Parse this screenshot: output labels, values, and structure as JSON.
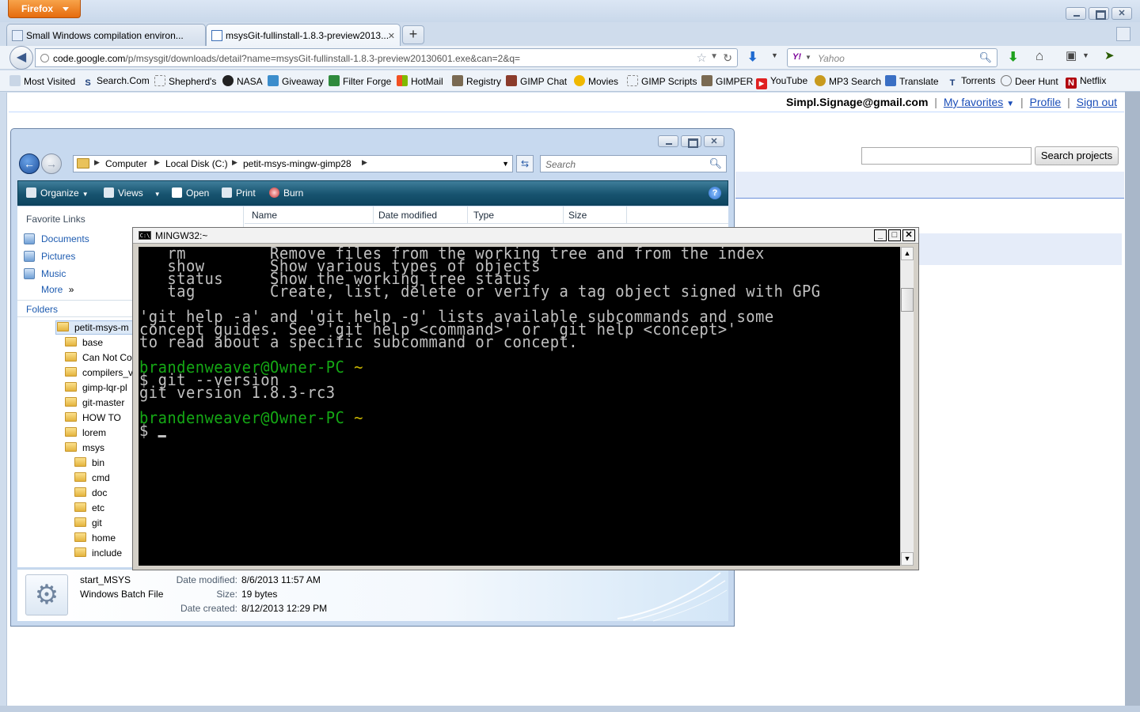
{
  "firefox": {
    "menu_button": "Firefox",
    "tabs": [
      {
        "label": "Small Windows compilation environ..."
      },
      {
        "label": "msysGit-fullinstall-1.8.3-preview2013..."
      }
    ],
    "url": {
      "host": "code.google.com",
      "path": "/p/msysgit/downloads/detail?name=msysGit-fullinstall-1.8.3-preview20130601.exe&can=2&q="
    },
    "search_placeholder": "Yahoo",
    "bookmarks": [
      {
        "label": "Most Visited",
        "icon": "star-icon"
      },
      {
        "label": "Search.Com",
        "icon": "search-com-icon"
      },
      {
        "label": "Shepherd's",
        "icon": "page-icon"
      },
      {
        "label": "NASA",
        "icon": "nasa-icon"
      },
      {
        "label": "Giveaway",
        "icon": "giveaway-icon"
      },
      {
        "label": "Filter Forge",
        "icon": "filter-forge-icon"
      },
      {
        "label": "HotMail",
        "icon": "windows-icon"
      },
      {
        "label": "Registry",
        "icon": "gimp-icon"
      },
      {
        "label": "GIMP Chat",
        "icon": "gimp-chat-icon"
      },
      {
        "label": "Movies",
        "icon": "movies-icon"
      },
      {
        "label": "GIMP Scripts",
        "icon": "page-icon"
      },
      {
        "label": "GIMPER",
        "icon": "gimp-icon"
      },
      {
        "label": "YouTube",
        "icon": "youtube-icon"
      },
      {
        "label": "MP3 Search",
        "icon": "mp3-icon"
      },
      {
        "label": "Translate",
        "icon": "translate-icon"
      },
      {
        "label": "Torrents",
        "icon": "torrents-icon"
      },
      {
        "label": "Deer Hunt",
        "icon": "deer-hunt-icon"
      },
      {
        "label": "Netflix",
        "icon": "netflix-icon"
      }
    ]
  },
  "page": {
    "account_email": "Simpl.Signage@gmail.com",
    "my_favorites": "My favorites",
    "favorites_arrow": "▼",
    "profile": "Profile",
    "sign_out": "Sign out",
    "sep": "|",
    "search_button": "Search projects"
  },
  "explorer": {
    "breadcrumb": [
      "Computer",
      "Local Disk (C:)",
      "petit-msys-mingw-gimp28"
    ],
    "search_placeholder": "Search",
    "toolbar": {
      "organize": "Organize",
      "views": "Views",
      "open": "Open",
      "print": "Print",
      "burn": "Burn"
    },
    "favorite_links_title": "Favorite Links",
    "favorite_links": [
      "Documents",
      "Pictures",
      "Music"
    ],
    "more": "More",
    "more_arrows": "»",
    "folders_title": "Folders",
    "tree": [
      {
        "label": "petit-msys-m",
        "level": 0
      },
      {
        "label": "base",
        "level": 1
      },
      {
        "label": "Can Not Co",
        "level": 1
      },
      {
        "label": "compilers_v",
        "level": 1
      },
      {
        "label": "gimp-lqr-pl",
        "level": 1
      },
      {
        "label": "git-master",
        "level": 1
      },
      {
        "label": "HOW TO",
        "level": 1
      },
      {
        "label": "lorem",
        "level": 1
      },
      {
        "label": "msys",
        "level": 1
      },
      {
        "label": "bin",
        "level": 2
      },
      {
        "label": "cmd",
        "level": 2
      },
      {
        "label": "doc",
        "level": 2
      },
      {
        "label": "etc",
        "level": 2
      },
      {
        "label": "git",
        "level": 2
      },
      {
        "label": "home",
        "level": 2
      },
      {
        "label": "include",
        "level": 2
      }
    ],
    "columns": [
      "Name",
      "Date modified",
      "Type",
      "Size"
    ],
    "details": {
      "name": "start_MSYS",
      "type": "Windows Batch File",
      "modified_label": "Date modified:",
      "modified": "8/6/2013 11:57 AM",
      "size_label": "Size:",
      "size": "19 bytes",
      "created_label": "Date created:",
      "created": "8/12/2013 12:29 PM"
    }
  },
  "console": {
    "title": "MINGW32:~",
    "icon_text": "C:\\",
    "lines": [
      {
        "text": "   rm         Remove files from the working tree and from the index",
        "color": "white"
      },
      {
        "text": "   show       Show various types of objects",
        "color": "white"
      },
      {
        "text": "   status     Show the working tree status",
        "color": "white"
      },
      {
        "text": "   tag        Create, list, delete or verify a tag object signed with GPG",
        "color": "white"
      },
      {
        "text": "",
        "color": "white"
      },
      {
        "text": "'git help -a' and 'git help -g' lists available subcommands and some",
        "color": "white"
      },
      {
        "text": "concept guides. See 'git help <command>' or 'git help <concept>'",
        "color": "white"
      },
      {
        "text": "to read about a specific subcommand or concept.",
        "color": "white"
      },
      {
        "text": "",
        "color": "white"
      },
      {
        "text": "brandenweaver@Owner-PC ~",
        "color": "prompt"
      },
      {
        "text": "$ git --version",
        "color": "white"
      },
      {
        "text": "git version 1.8.3-rc3",
        "color": "white"
      },
      {
        "text": "",
        "color": "white"
      },
      {
        "text": "brandenweaver@Owner-PC ~",
        "color": "prompt"
      },
      {
        "text": "$ ",
        "color": "cursor"
      }
    ]
  }
}
